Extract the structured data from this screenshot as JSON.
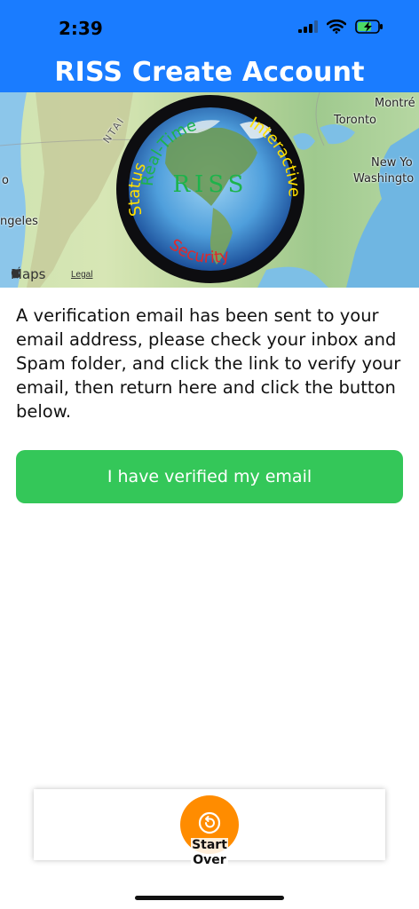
{
  "status_bar": {
    "time": "2:39"
  },
  "header": {
    "title": "RISS Create Account"
  },
  "map": {
    "labels": {
      "montreal": "Montré",
      "toronto": "Toronto",
      "new_york": "New Yo",
      "washington": "Washingto",
      "los_angeles": "ngeles",
      "to": "o",
      "mountain": "NTAI"
    },
    "brand": "Maps",
    "legal": "Legal"
  },
  "logo": {
    "center_text": "RISS",
    "top_text": "Real-Time",
    "right_text": "Interactive",
    "left_text": "Status",
    "bottom_text": "Security"
  },
  "main": {
    "message": "A verification email has been sent to your email address, please check your inbox and Spam folder, and click the link to verify your email, then return here and click the button below.",
    "verify_button": "I have verified my email"
  },
  "bottom": {
    "start_over_label_line1": "Start",
    "start_over_label_line2": "Over"
  },
  "colors": {
    "header_blue": "#1a7cff",
    "verify_green": "#34c759",
    "start_over_orange": "#ff8c00"
  }
}
